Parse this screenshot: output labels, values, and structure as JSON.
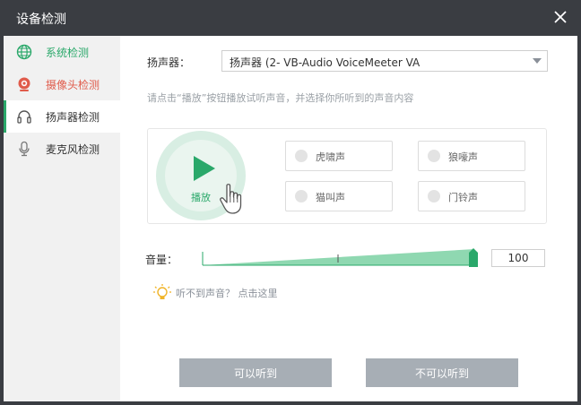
{
  "window": {
    "title": "设备检测"
  },
  "colors": {
    "accent": "#2aa86a",
    "red": "#e05b4b",
    "titlebar": "#3a3d42",
    "button": "#a7aeb5"
  },
  "sidebar": {
    "items": [
      {
        "label": "系统检测",
        "icon": "globe-icon",
        "color": "#2aa86a",
        "active": false
      },
      {
        "label": "摄像头检测",
        "icon": "webcam-icon",
        "color": "#e05b4b",
        "active": false
      },
      {
        "label": "扬声器检测",
        "icon": "headphones-icon",
        "color": "#333333",
        "active": true
      },
      {
        "label": "麦克风检测",
        "icon": "microphone-icon",
        "color": "#333333",
        "active": false
      }
    ]
  },
  "main": {
    "speaker_label": "扬声器：",
    "speaker_value": "扬声器 (2- VB-Audio VoiceMeeter VA",
    "hint": "请点击“播放”按钮播放试听声音，并选择你所听到的声音内容",
    "play_label": "播放",
    "options": [
      "虎啸声",
      "狼嚎声",
      "猫叫声",
      "门铃声"
    ],
    "volume_label": "音量：",
    "volume_value": "100",
    "volume_level": 1.0,
    "help_text": "听不到声音？ 点击这里",
    "can_hear": "可以听到",
    "cannot_hear": "不可以听到"
  }
}
